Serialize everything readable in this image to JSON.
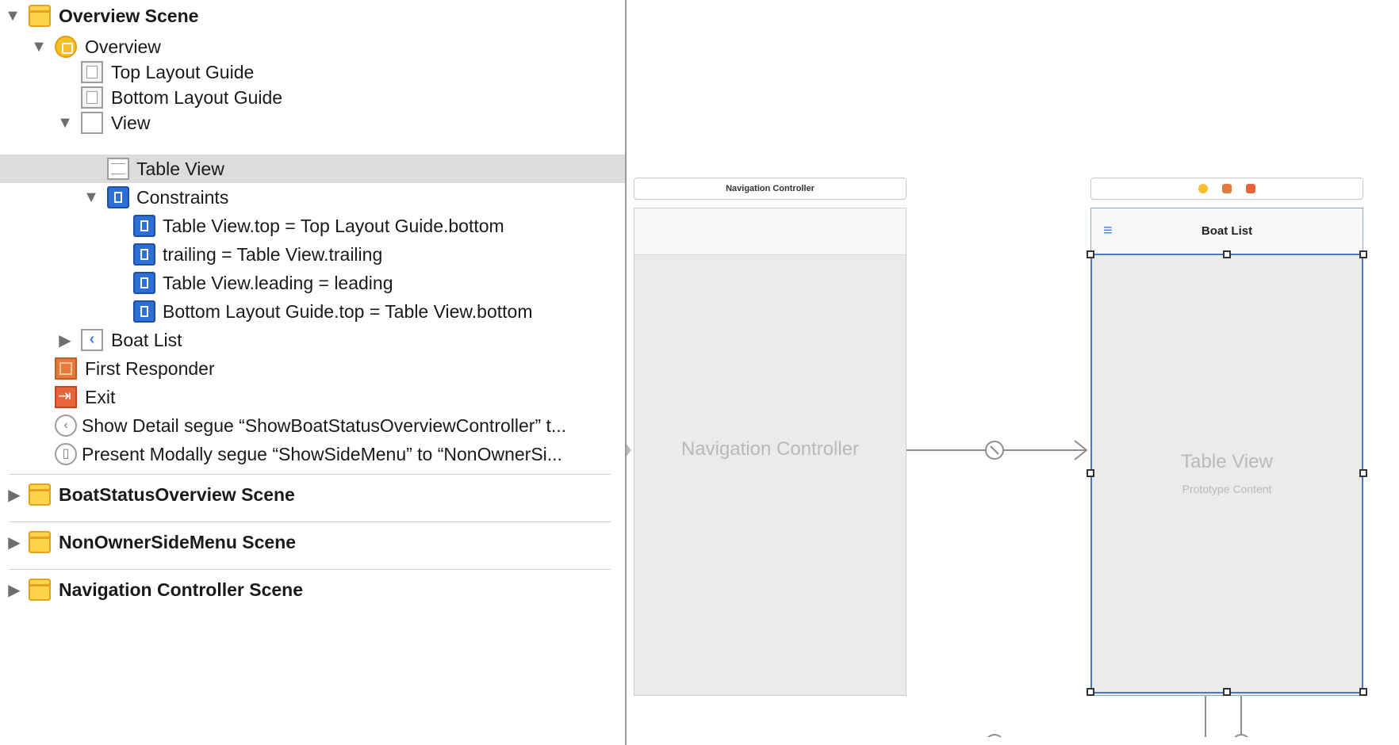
{
  "outline": {
    "rows": [
      {
        "label": "Overview Scene"
      },
      {
        "label": "Overview"
      },
      {
        "label": "Top Layout Guide"
      },
      {
        "label": "Bottom Layout Guide"
      },
      {
        "label": "View"
      },
      {
        "label": "Table View"
      },
      {
        "label": "Constraints"
      },
      {
        "label": "Table View.top = Top Layout Guide.bottom"
      },
      {
        "label": "trailing = Table View.trailing"
      },
      {
        "label": "Table View.leading = leading"
      },
      {
        "label": "Bottom Layout Guide.top = Table View.bottom"
      },
      {
        "label": "Boat List"
      },
      {
        "label": "First Responder"
      },
      {
        "label": "Exit"
      },
      {
        "label": "Show Detail segue “ShowBoatStatusOverviewController” t..."
      },
      {
        "label": "Present Modally segue “ShowSideMenu” to “NonOwnerSi..."
      },
      {
        "label": "BoatStatusOverview Scene"
      },
      {
        "label": "NonOwnerSideMenu Scene"
      },
      {
        "label": "Navigation Controller Scene"
      }
    ]
  },
  "canvas": {
    "nav_scene_bar_title": "Navigation Controller",
    "nav_screen_label": "Navigation Controller",
    "boat_list_nav_title": "Boat List",
    "table_view_label": "Table View",
    "table_view_sublabel": "Prototype Content"
  },
  "colors": {
    "selection": "#dcdcdc",
    "scene_icon": "#fcd34a",
    "constraint_icon": "#2e6fd4",
    "selection_outline": "#4a78c2"
  }
}
